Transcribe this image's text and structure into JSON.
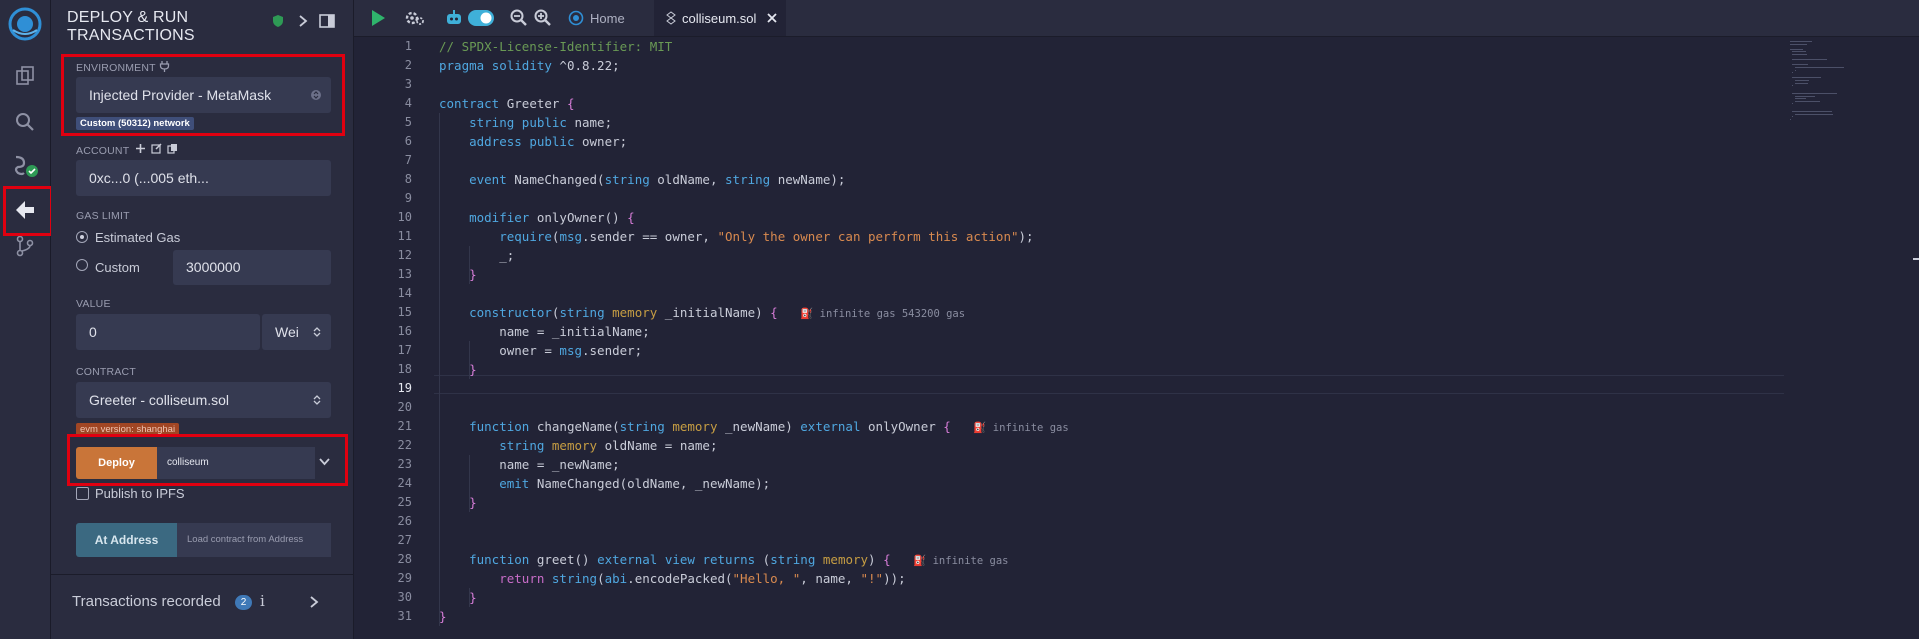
{
  "panel": {
    "title": "DEPLOY & RUN TRANSACTIONS",
    "environment": {
      "label": "ENVIRONMENT",
      "value": "Injected Provider - MetaMask",
      "network_badge": "Custom (50312) network"
    },
    "account": {
      "label": "ACCOUNT",
      "value": "0xc...0 (...005 eth..."
    },
    "gas_limit": {
      "label": "GAS LIMIT",
      "estimated": "Estimated Gas",
      "custom": "Custom",
      "custom_value": "3000000"
    },
    "value": {
      "label": "VALUE",
      "amount": "0",
      "unit": "Wei"
    },
    "contract": {
      "label": "CONTRACT",
      "value": "Greeter - colliseum.sol",
      "evm_badge": "evm version: shanghai"
    },
    "deploy": {
      "button": "Deploy",
      "arg": "colliseum"
    },
    "publish_ipfs": "Publish to IPFS",
    "at_address": {
      "button": "At Address",
      "placeholder": "Load contract from Address"
    },
    "transactions": {
      "title": "Transactions recorded",
      "count": "2",
      "info": "i"
    }
  },
  "tabs": {
    "home": "Home",
    "file": "colliseum.sol"
  },
  "editor": {
    "current_line": 19,
    "gas_hints": {
      "constructor": "infinite gas 543200 gas",
      "changeName": "infinite gas",
      "greet": "infinite gas"
    },
    "lines": [
      "// SPDX-License-Identifier: MIT",
      "pragma solidity ^0.8.22;",
      "",
      "contract Greeter {",
      "    string public name;",
      "    address public owner;",
      "",
      "    event NameChanged(string oldName, string newName);",
      "",
      "    modifier onlyOwner() {",
      "        require(msg.sender == owner, \"Only the owner can perform this action\");",
      "        _;",
      "    }",
      "",
      "    constructor(string memory _initialName) {",
      "        name = _initialName;",
      "        owner = msg.sender;",
      "    }",
      "",
      "",
      "    function changeName(string memory _newName) external onlyOwner {",
      "        string memory oldName = name;",
      "        name = _newName;",
      "        emit NameChanged(oldName, _newName);",
      "    }",
      "",
      "",
      "    function greet() external view returns (string memory) {",
      "        return string(abi.encodePacked(\"Hello, \", name, \"!\"));",
      "    }",
      "}"
    ]
  },
  "colors": {
    "accent_orange": "#c97539",
    "highlight_red": "#e00010",
    "at_address_blue": "#3b6981",
    "background": "#222336"
  }
}
